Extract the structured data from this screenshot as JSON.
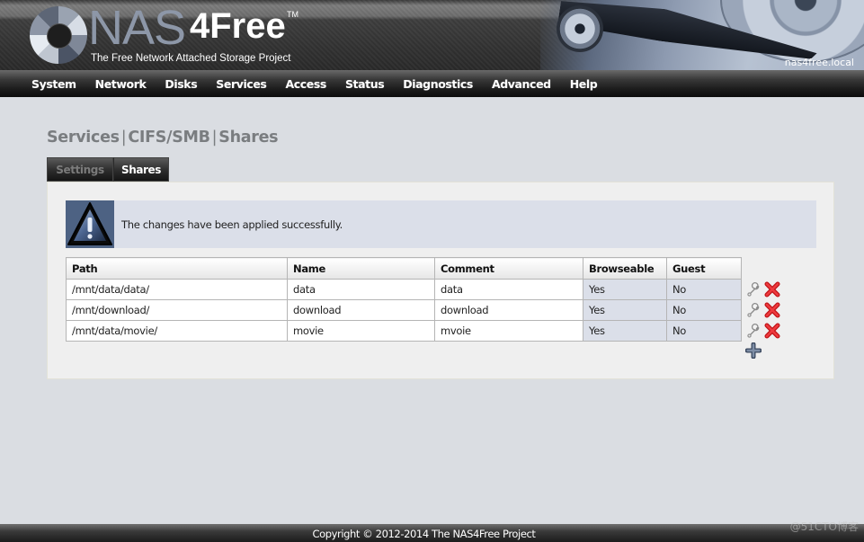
{
  "header": {
    "logo_nas": "NAS",
    "logo_free": "4Free",
    "logo_tm": "TM",
    "tagline": "The Free Network Attached Storage Project",
    "hostname": "nas4free.local"
  },
  "nav": {
    "items": [
      {
        "label": "System"
      },
      {
        "label": "Network"
      },
      {
        "label": "Disks"
      },
      {
        "label": "Services"
      },
      {
        "label": "Access"
      },
      {
        "label": "Status"
      },
      {
        "label": "Diagnostics"
      },
      {
        "label": "Advanced"
      },
      {
        "label": "Help"
      }
    ]
  },
  "page": {
    "breadcrumb": [
      "Services",
      "CIFS/SMB",
      "Shares"
    ],
    "separator": "|",
    "tabs": [
      {
        "label": "Settings",
        "active": false
      },
      {
        "label": "Shares",
        "active": true
      }
    ]
  },
  "alert": {
    "icon": "warning-icon",
    "message": "The changes have been applied successfully."
  },
  "table": {
    "headers": [
      "Path",
      "Name",
      "Comment",
      "Browseable",
      "Guest"
    ],
    "rows": [
      {
        "path": "/mnt/data/data/",
        "name": "data",
        "comment": "data",
        "browseable": "Yes",
        "guest": "No"
      },
      {
        "path": "/mnt/download/",
        "name": "download",
        "comment": "download",
        "browseable": "Yes",
        "guest": "No"
      },
      {
        "path": "/mnt/data/movie/",
        "name": "movie",
        "comment": "mvoie",
        "browseable": "Yes",
        "guest": "No"
      }
    ],
    "row_actions": [
      "edit-wrench-icon",
      "delete-x-icon"
    ],
    "add_action": "add-plus-icon"
  },
  "footer": {
    "copyright": "Copyright © 2012-2014 The NAS4Free Project",
    "watermark": "@51CTO博客"
  },
  "colors": {
    "background": "#dadde2",
    "panel": "#efefef",
    "alert_bg": "#dbdfe9",
    "alert_icon_bg": "#4d6283",
    "delete_red": "#d81e22",
    "add_blue": "#52627c"
  }
}
